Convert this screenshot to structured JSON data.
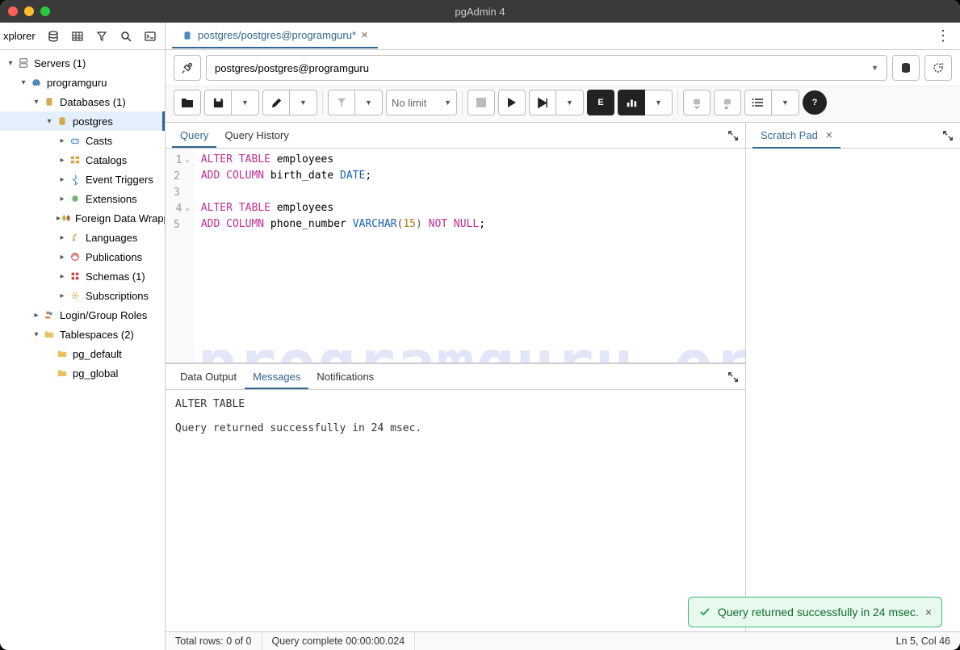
{
  "title": "pgAdmin 4",
  "explorer_title": "xplorer",
  "tree": {
    "servers": "Servers (1)",
    "server_name": "programguru",
    "databases": "Databases (1)",
    "db": "postgres",
    "items": [
      "Casts",
      "Catalogs",
      "Event Triggers",
      "Extensions",
      "Foreign Data Wrappers",
      "Languages",
      "Publications",
      "Schemas (1)",
      "Subscriptions"
    ],
    "login_roles": "Login/Group Roles",
    "tablespaces": "Tablespaces (2)",
    "ts_items": [
      "pg_default",
      "pg_global"
    ]
  },
  "tab_label": "postgres/postgres@programguru*",
  "conn_text": "postgres/postgres@programguru",
  "limit_label": "No limit",
  "subtabs": {
    "query": "Query",
    "history": "Query History"
  },
  "scratch_label": "Scratch Pad",
  "code_lines": [
    [
      {
        "t": "ALTER TABLE",
        "c": "kw"
      },
      {
        "t": " employees",
        "c": ""
      }
    ],
    [
      {
        "t": "ADD COLUMN",
        "c": "kw"
      },
      {
        "t": " birth_date ",
        "c": ""
      },
      {
        "t": "DATE",
        "c": "type"
      },
      {
        "t": ";",
        "c": ""
      }
    ],
    [],
    [
      {
        "t": "ALTER TABLE",
        "c": "kw"
      },
      {
        "t": " employees",
        "c": ""
      }
    ],
    [
      {
        "t": "ADD COLUMN",
        "c": "kw"
      },
      {
        "t": " phone_number ",
        "c": ""
      },
      {
        "t": "VARCHAR",
        "c": "type"
      },
      {
        "t": "(",
        "c": "paren"
      },
      {
        "t": "15",
        "c": "num"
      },
      {
        "t": ")",
        "c": "paren"
      },
      {
        "t": " ",
        "c": ""
      },
      {
        "t": "NOT NULL",
        "c": "kw"
      },
      {
        "t": ";",
        "c": ""
      }
    ]
  ],
  "watermark": "programguru.org",
  "output_tabs": {
    "data": "Data Output",
    "messages": "Messages",
    "notifications": "Notifications"
  },
  "messages_text": "ALTER TABLE\n\nQuery returned successfully in 24 msec.",
  "status": {
    "rows": "Total rows: 0 of 0",
    "time": "Query complete 00:00:00.024",
    "pos": "Ln 5, Col 46"
  },
  "toast": "Query returned successfully in 24 msec."
}
